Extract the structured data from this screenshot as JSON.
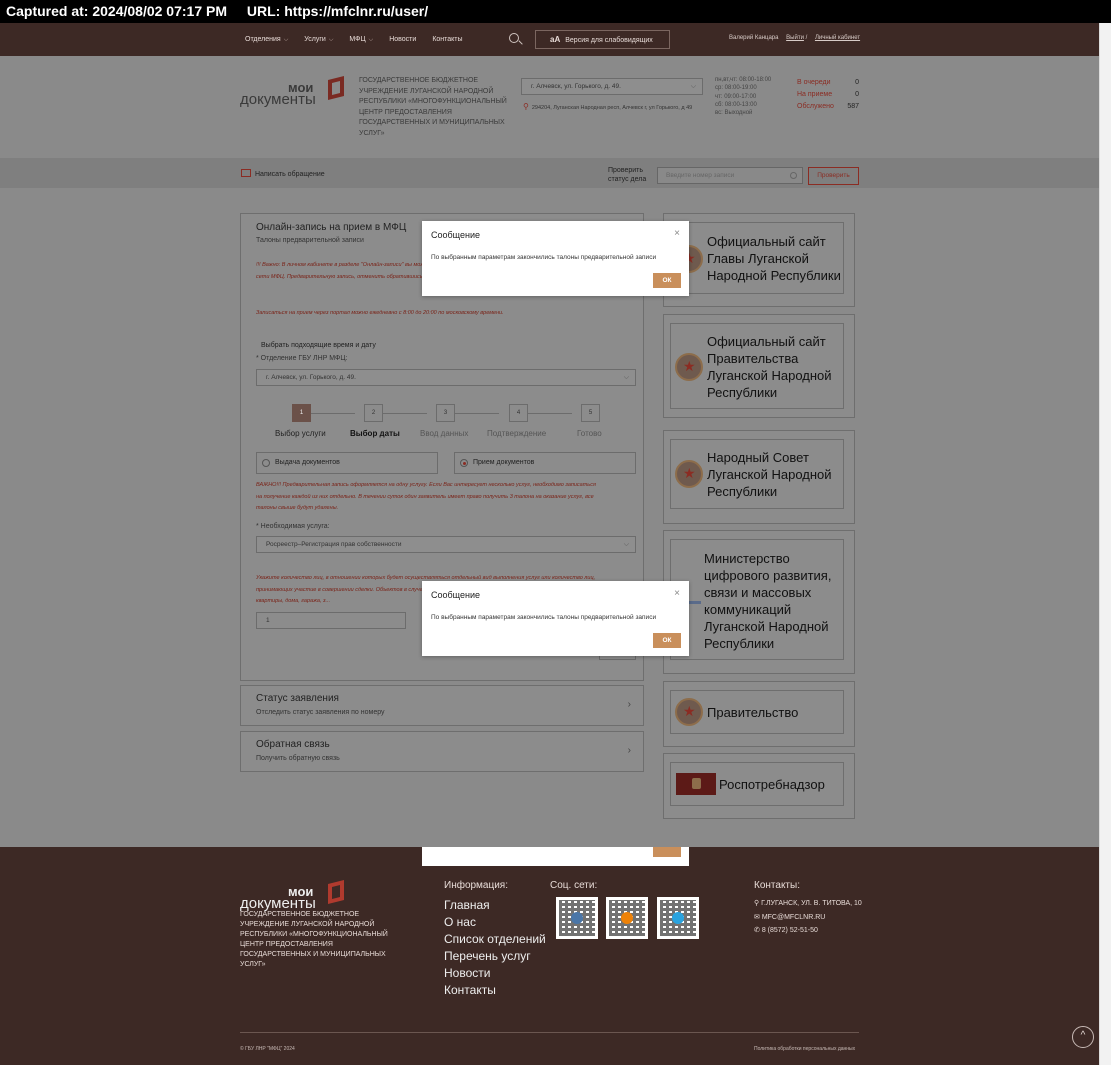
{
  "capture": {
    "captured_at": "Captured at: 2024/08/02 07:17 PM",
    "url": "URL: https://mfclnr.ru/user/"
  },
  "topnav": {
    "menu": [
      {
        "label": "Отделения",
        "has_dropdown": true
      },
      {
        "label": "Услуги",
        "has_dropdown": true
      },
      {
        "label": "МФЦ",
        "has_dropdown": true
      },
      {
        "label": "Новости",
        "has_dropdown": false
      },
      {
        "label": "Контакты",
        "has_dropdown": false
      }
    ],
    "vision_button": "Версия для слабовидящих",
    "vision_icon": "аА",
    "user_name": "Валерий Канцара",
    "logout": "Выйти",
    "separator": "/",
    "cabinet": "Личный кабинет"
  },
  "header": {
    "logo_line1": "мои",
    "logo_line2": "документы",
    "org_name": "ГОСУДАРСТВЕННОЕ БЮДЖЕТНОЕ УЧРЕЖДЕНИЕ ЛУГАНСКОЙ НАРОДНОЙ РЕСПУБЛИКИ «МНОГОФУНКЦИОНАЛЬНЫЙ ЦЕНТР ПРЕДОСТАВЛЕНИЯ ГОСУДАРСТВЕННЫХ И МУНИЦИПАЛЬНЫХ УСЛУГ»",
    "branch_selected": "г. Алчевск, ул. Горького, д. 49.",
    "address": "294204, Луганская Народная респ, Алчевск г, ул Горького, д 49",
    "hours": [
      "пн,вт,чт: 08:00-18:00",
      "ср: 08:00-19:00",
      "чт: 09:00-17:00",
      "сб: 08:00-13:00",
      "вс: Выходной"
    ],
    "queue": [
      {
        "label": "В очереди",
        "value": "0"
      },
      {
        "label": "На приеме",
        "value": "0"
      },
      {
        "label": "Обслужено",
        "value": "587"
      }
    ]
  },
  "tools": {
    "write_appeal": "Написать обращение",
    "check_status_label": "Проверить статус дела",
    "check_placeholder": "Введите номер записи",
    "check_button": "Проверить"
  },
  "booking": {
    "title": "Онлайн-запись на прием в МФЦ",
    "subtitle": "Талоны предварительной записи",
    "warning1": "!!! Важно: В личном кабинете в разделе \"Онлайн-записи\" вы можете отменить запись. Отменить запись, осуществленную через сайт сети МФЦ. Предварительную запись, отменить обратившись в контакт-центр.",
    "warning2": "Записаться на прием через портал можно ежедневно с 8:00 до 20:00 по московскому времени.",
    "pick_time_label": "Выбрать подходящие время и дату",
    "department_label": "* Отделение ГБУ ЛНР МФЦ:",
    "department_value": "г. Алчевск, ул. Горького, д. 49.",
    "steps": [
      {
        "num": "1",
        "label": "Выбор услуги"
      },
      {
        "num": "2",
        "label": "Выбор даты"
      },
      {
        "num": "3",
        "label": "Ввод данных"
      },
      {
        "num": "4",
        "label": "Подтверждение"
      },
      {
        "num": "5",
        "label": "Готово"
      }
    ],
    "radio_issue": "Выдача документов",
    "radio_accept": "Прием документов",
    "warning3": "ВАЖНО!!! Предварительная запись оформляется на одну услугу. Если Вас интересует несколько услуг, необходимо записаться на получение каждой из них отдельно. В течении суток один заявитель имеет право получить 3 талона на оказание услуг, все талоны свыше будут удалены.",
    "service_label": "* Необходимая услуга:",
    "service_value": "Росреестр–Регистрация прав собственности",
    "warning4": "Укажите количество лиц, в отношении которых будет осуществляться отдельный вид выполнения услуг или количество лиц, принимающих участие в совершении сделки. Объектов в случае, если услуга оказывается только одного объекта (здания, квартиры, дома, гаража, з...",
    "qty_value": "1"
  },
  "status_block": {
    "title": "Статус заявления",
    "subtitle": "Отследить статус заявления по номеру"
  },
  "feedback_block": {
    "title": "Обратная связь",
    "subtitle": "Получить обратную связь"
  },
  "sidebar": [
    {
      "text": "Официальный сайт Главы Луганской Народной Республики",
      "icon": "lnr-emblem-icon"
    },
    {
      "text": "Официальный сайт Правительства Луганской Народной Республики",
      "icon": "lnr-emblem-icon"
    },
    {
      "text": "Народный Совет Луганской Народной Республики",
      "icon": "lnr-emblem-icon"
    },
    {
      "text": "Министерство цифрового развития, связи и массовых коммуникаций Луганской Народной Республики",
      "icon": "ministry-icon"
    },
    {
      "text": "Правительство",
      "icon": "lnr-emblem-icon"
    },
    {
      "text": "Роспотребнадзор",
      "icon": "rospotrebnadzor-icon"
    }
  ],
  "modal": {
    "title": "Сообщение",
    "body": "По выбранным параметрам закончились талоны предварительной записи",
    "ok": "ОК",
    "close": "×"
  },
  "footer": {
    "logo_line1": "мои",
    "logo_line2": "документы",
    "org_name": "ГОСУДАРСТВЕННОЕ БЮДЖЕТНОЕ УЧРЕЖДЕНИЕ ЛУГАНСКОЙ НАРОДНОЙ РЕСПУБЛИКИ «МНОГОФУНКЦИОНАЛЬНЫЙ ЦЕНТР ПРЕДОСТАВЛЕНИЯ ГОСУДАРСТВЕННЫХ И МУНИЦИПАЛЬНЫХ УСЛУГ»",
    "info_heading": "Информация:",
    "links": [
      "Главная",
      "О нас",
      "Список отделений",
      "Перечень услуг",
      "Новости",
      "Контакты"
    ],
    "social_heading": "Соц. сети:",
    "contacts_heading": "Контакты:",
    "address": "Г.ЛУГАНСК, УЛ. В. ТИТОВА, 10",
    "email": "MFC@MFCLNR.RU",
    "phone": "8 (8572) 52-51-50",
    "copyright": "© ГБУ ЛНР \"МФЦ\" 2024",
    "policy": "Политика обработки персональных данных",
    "to_top": "^"
  },
  "colors": {
    "brand_brown": "#3d2925",
    "accent_red": "#8b2c23",
    "ok_button": "#c98f5b"
  }
}
